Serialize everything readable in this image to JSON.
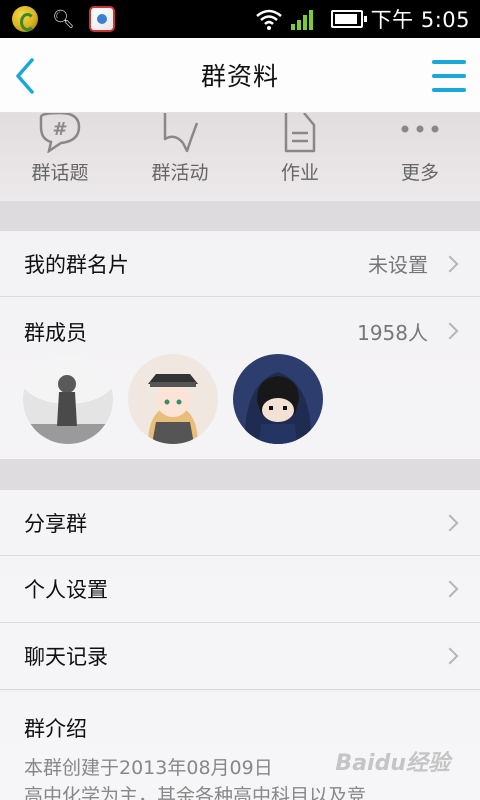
{
  "status_bar": {
    "time": "下午 5:05",
    "icons": [
      "app-icon",
      "search-icon",
      "qq-icon",
      "wifi-icon",
      "signal-icon",
      "battery-icon"
    ]
  },
  "title_bar": {
    "title": "群资料",
    "back_icon": "chevron-left-icon",
    "menu_icon": "hamburger-menu-icon",
    "accent": "#19a8d8"
  },
  "quick_actions": [
    {
      "label": "群话题",
      "icon": "hashtag-bubble-icon"
    },
    {
      "label": "群活动",
      "icon": "flag-icon"
    },
    {
      "label": "作业",
      "icon": "document-icon"
    },
    {
      "label": "更多",
      "icon": "more-dots-icon"
    }
  ],
  "card": {
    "label": "我的群名片",
    "value": "未设置"
  },
  "members": {
    "label": "群成员",
    "count": "1958人",
    "avatars": [
      "avatar-1",
      "avatar-2",
      "avatar-3"
    ]
  },
  "menu_items": [
    {
      "label": "分享群"
    },
    {
      "label": "个人设置"
    },
    {
      "label": "聊天记录"
    }
  ],
  "intro": {
    "title": "群介绍",
    "line1": "本群创建于2013年08月09日",
    "line2": "高中化学为主，其余各种高中科目以及竞"
  },
  "watermark": "Baidu经验"
}
